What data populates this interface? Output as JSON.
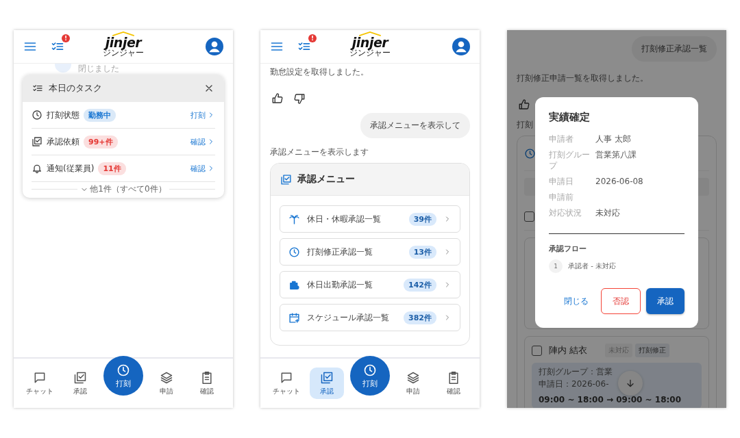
{
  "screen_1": {
    "header": {
      "logo": "jinjer",
      "logo_sub": "ジンジャー",
      "alert": "!"
    },
    "chat_behind": "閉じました",
    "task_panel": {
      "title": "本日のタスク",
      "rows": [
        {
          "kind": "punch",
          "label": "打刻状態",
          "badge": "勤務中",
          "color": "#1976d2",
          "action": "打刻"
        },
        {
          "kind": "approval",
          "label": "承認依頼",
          "badge": "99+件",
          "color": "#e53935",
          "action": "確認"
        },
        {
          "kind": "notification",
          "label": "通知(従業員)",
          "badge": "11件",
          "color": "#e53935",
          "action": "確認"
        }
      ],
      "more": "他1件（すべて0件）"
    },
    "nav": [
      {
        "kind": "chat",
        "label": "チャット",
        "selected": false
      },
      {
        "kind": "approval",
        "label": "承認",
        "selected": false
      },
      {
        "kind": "punch",
        "label": "打刻",
        "selected": false
      },
      {
        "kind": "request",
        "label": "申請",
        "selected": false
      },
      {
        "kind": "check",
        "label": "確認",
        "selected": false
      }
    ]
  },
  "screen_2": {
    "header": {
      "logo": "jinjer",
      "logo_sub": "ジンジャー",
      "alert": "!"
    },
    "message": "勤怠設定を取得しました。",
    "user_bubble": "承認メニューを表示して",
    "reply": "承認メニューを表示します",
    "menu": {
      "title": "承認メニュー",
      "items": [
        {
          "kind": "leave",
          "label": "休日・休暇承認一覧",
          "count": "39件"
        },
        {
          "kind": "correction",
          "label": "打刻修正承認一覧",
          "count": "13件"
        },
        {
          "kind": "holiday_work",
          "label": "休日出勤承認一覧",
          "count": "142件"
        },
        {
          "kind": "schedule",
          "label": "スケジュール承認一覧",
          "count": "382件"
        }
      ]
    },
    "nav": [
      {
        "kind": "chat",
        "label": "チャット",
        "selected": false
      },
      {
        "kind": "approval",
        "label": "承認",
        "selected": true
      },
      {
        "kind": "punch",
        "label": "打刻",
        "selected": false
      },
      {
        "kind": "request",
        "label": "申請",
        "selected": false
      },
      {
        "kind": "check",
        "label": "確認",
        "selected": false
      }
    ]
  },
  "screen_3": {
    "user_bubble": "打刻修正承認一覧",
    "message": "打刻修正申請一覧を取得しました。",
    "partial": "打刻",
    "select_all": {
      "checked": false
    },
    "entry": {
      "checked": false,
      "name": "陣内 結衣",
      "status": "未対応",
      "type": "打刻修正",
      "group": "打刻グループ：営業",
      "date": "申請日：2026-06-",
      "time": "09:00 ~ 18:00 → 09:00 ~ 18:00"
    },
    "dialog": {
      "title": "実績確定",
      "fields": [
        {
          "label": "申請者",
          "value": "人事 太郎"
        },
        {
          "label": "打刻グループ",
          "value": "営業第八課"
        },
        {
          "label": "申請日",
          "value": "2026-06-08"
        },
        {
          "label": "申請前"
        },
        {
          "label": "対応状況",
          "value": "未対応"
        }
      ],
      "flow_title": "承認フロー",
      "steps": [
        {
          "number": "1",
          "text": "承認者 - 未対応"
        }
      ],
      "buttons": [
        {
          "kind": "text",
          "label": "閉じる"
        },
        {
          "kind": "outlined",
          "label": "否認"
        },
        {
          "kind": "primary",
          "label": "承認"
        }
      ]
    }
  }
}
